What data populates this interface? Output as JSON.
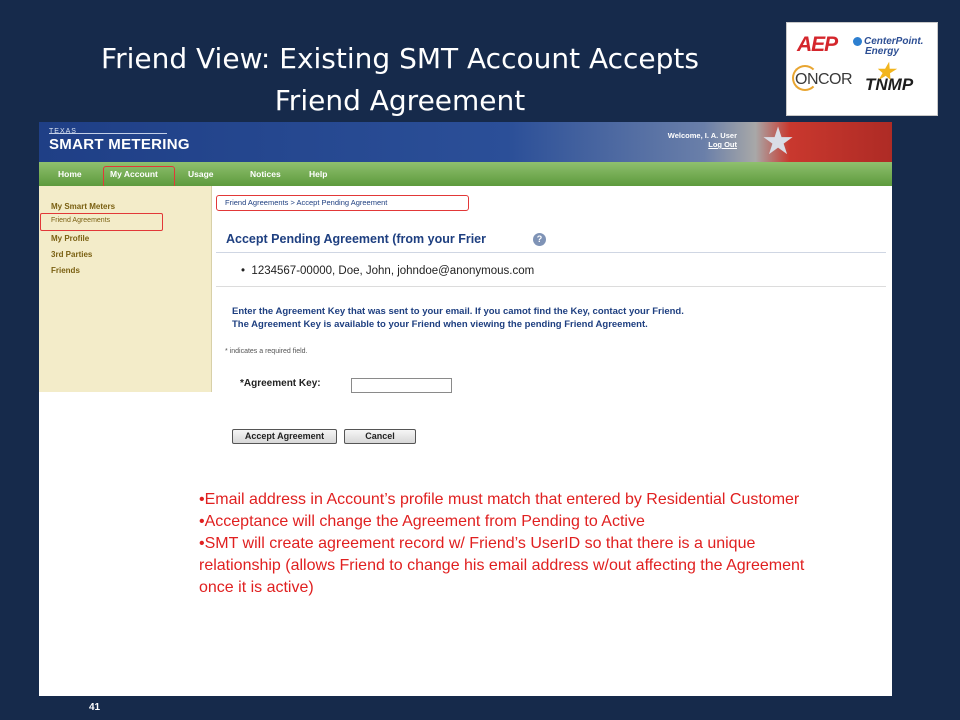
{
  "slide": {
    "title_line1": "Friend View:  Existing SMT Account Accepts",
    "title_line2": "Friend Agreement",
    "page_number": "41",
    "logos": {
      "aep": "AEP",
      "centerpoint_line1": "CenterPoint.",
      "centerpoint_line2": "Energy",
      "oncor": "ONCOR",
      "tnmp": "TNMP"
    }
  },
  "site": {
    "logo_small": "TEXAS",
    "logo": "SMART METERING",
    "welcome": "Welcome, I. A. User",
    "logout": "Log Out",
    "colors": {
      "header_blue": "#1f3f86",
      "nav_green": "#5d9a3d",
      "highlight_red": "#e23838"
    }
  },
  "nav": {
    "items": [
      "Home",
      "My Account",
      "Usage",
      "Notices",
      "Help"
    ]
  },
  "sidebar": {
    "items": [
      "My Smart Meters",
      "My Profile",
      "3rd Parties",
      "Friends"
    ],
    "sub_item": "Friend Agreements"
  },
  "main": {
    "breadcrumb": "Friend Agreements > Accept Pending Agreement",
    "title": "Accept Pending Agreement (from your Frier",
    "help_icon": "?",
    "account_line": "1234567-00000,  Doe, John, johndoe@anonymous.com",
    "bullet": "•",
    "instructions_line1": "Enter the Agreement Key that was sent to your email.  If you camot find the Key, contact your Friend.",
    "instructions_line2": "The Agreement Key is available to your Friend when viewing the pending Friend Agreement.",
    "required_note": "* indicates a required field.",
    "key_label": "*Agreement Key:",
    "key_value": "",
    "accept_button": "Accept Agreement",
    "cancel_button": "Cancel"
  },
  "notes": [
    "•Email address in Account’s profile must match that entered by Residential Customer",
    "•Acceptance will change the Agreement from Pending to Active",
    "•SMT will create agreement record w/ Friend’s UserID so that there is a unique relationship (allows Friend to change his email address w/out affecting the Agreement once it is active)"
  ]
}
